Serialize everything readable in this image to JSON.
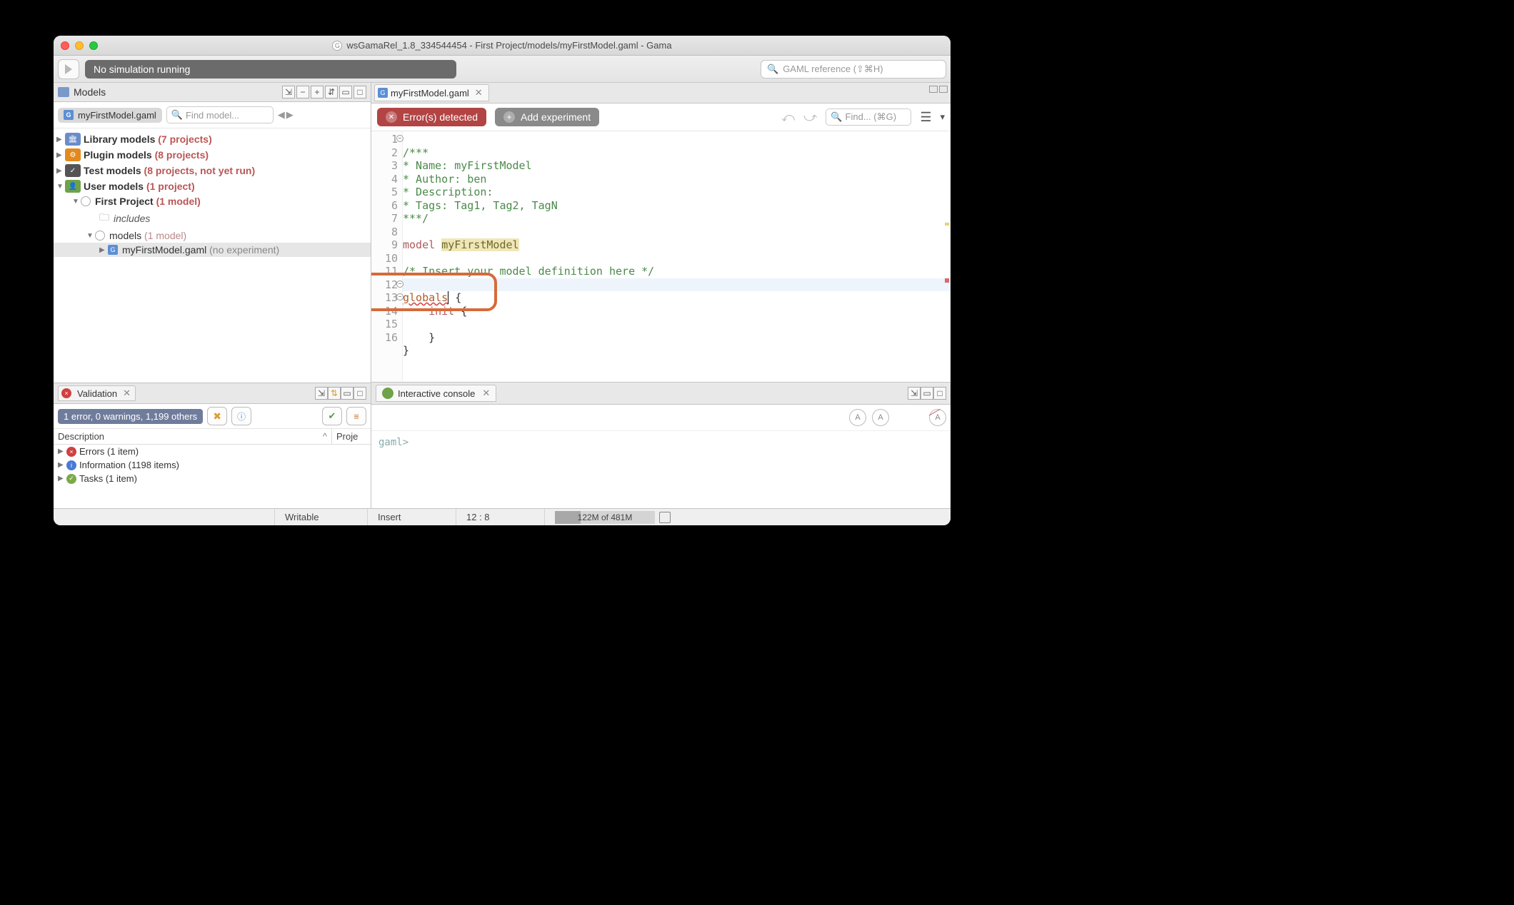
{
  "window": {
    "title": "wsGamaRel_1.8_334544454 - First Project/models/myFirstModel.gaml - Gama"
  },
  "toolbar": {
    "sim_status": "No simulation running",
    "gaml_ref_placeholder": "GAML reference (⇧⌘H)"
  },
  "models_pane": {
    "title": "Models",
    "open_file": "myFirstModel.gaml",
    "find_placeholder": "Find model...",
    "tree": {
      "library": {
        "label": "Library models",
        "count": "(7 projects)"
      },
      "plugin": {
        "label": "Plugin models",
        "count": "(8 projects)"
      },
      "test": {
        "label": "Test models",
        "count": "(8 projects, not yet run)"
      },
      "user": {
        "label": "User models",
        "count": "(1 project)"
      },
      "project": {
        "label": "First Project",
        "count": "(1 model)"
      },
      "includes": "includes",
      "models_folder": {
        "label": "models",
        "count": "(1 model)"
      },
      "file": {
        "label": "myFirstModel.gaml",
        "note": "(no experiment)"
      }
    }
  },
  "editor": {
    "tab": "myFirstModel.gaml",
    "errors_btn": "Error(s) detected",
    "add_exp_btn": "Add experiment",
    "find_placeholder": "Find... (⌘G)",
    "code": {
      "l1": "/***",
      "l2": "* Name: myFirstModel",
      "l3": "* Author: ben",
      "l4": "* Description:",
      "l5": "* Tags: Tag1, Tag2, TagN",
      "l6": "***/",
      "l8a": "model ",
      "l8b": "myFirstModel",
      "l10": "/* Insert your model definition here */",
      "l12a": "globals",
      "l12b": " {",
      "l13a": "    ",
      "l13b": "init",
      "l13c": " {",
      "l15": "    }",
      "l16": "}"
    }
  },
  "validation": {
    "title": "Validation",
    "summary": "1 error, 0 warnings, 1,199 others",
    "headers": {
      "desc": "Description",
      "proj": "Proje"
    },
    "items": {
      "errors": "Errors (1 item)",
      "info": "Information (1198 items)",
      "tasks": "Tasks (1 item)"
    }
  },
  "console": {
    "title": "Interactive console",
    "prompt": "gaml>"
  },
  "status": {
    "writable": "Writable",
    "insert": "Insert",
    "pos": "12 : 8",
    "mem": "122M of 481M"
  }
}
